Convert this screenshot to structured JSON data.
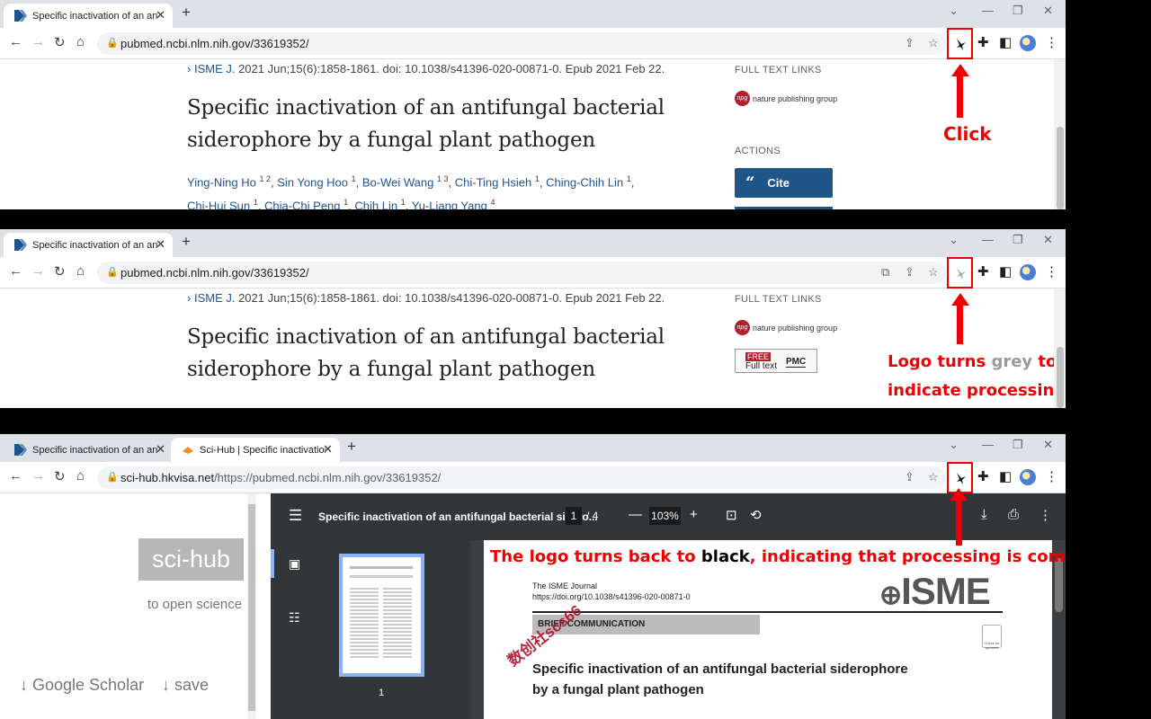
{
  "colors": {
    "annotation": "#ee0000",
    "tab_bar": "#dee1e6",
    "link": "#205493",
    "cite_button": "#20558a",
    "pdf_toolbar": "#323639"
  },
  "panels": {
    "p1": {
      "tab_title": "Specific inactivation of an antifun",
      "url": "pubmed.ncbi.nlm.nih.gov/33619352/",
      "journal_link": "ISME J.",
      "journal_rest": " 2021 Jun;15(6):1858-1861. doi: 10.1038/s41396-020-00871-0. Epub 2021 Feb 22.",
      "title_line1": "Specific inactivation of an antifungal bacterial",
      "title_line2": "siderophore by a fungal plant pathogen",
      "authors": [
        {
          "name": "Ying-Ning Ho",
          "sup": "1 2"
        },
        {
          "name": "Sin Yong Hoo",
          "sup": "1"
        },
        {
          "name": "Bo-Wei Wang",
          "sup": "1 3"
        },
        {
          "name": "Chi-Ting Hsieh",
          "sup": "1"
        },
        {
          "name": "Ching-Chih Lin",
          "sup": "1"
        },
        {
          "name": "Chi-Hui Sun",
          "sup": "1"
        },
        {
          "name": "Chia-Chi Peng",
          "sup": "1"
        },
        {
          "name": "Chih Lin",
          "sup": "1"
        },
        {
          "name": "Yu-Liang Yang",
          "sup": "4"
        }
      ],
      "full_text_links": "FULL TEXT LINKS",
      "npg_label": "nature publishing group",
      "npg_logo": "npg",
      "actions": "ACTIONS",
      "cite_icon": "“",
      "cite": "Cite",
      "annotation": "Click"
    },
    "p2": {
      "tab_title": "Specific inactivation of an antifun",
      "url": "pubmed.ncbi.nlm.nih.gov/33619352/",
      "journal_link": "ISME J.",
      "journal_rest": " 2021 Jun;15(6):1858-1861. doi: 10.1038/s41396-020-00871-0. Epub 2021 Feb 22.",
      "title_line1": "Specific inactivation of an antifungal bacterial",
      "title_line2": "siderophore by a fungal plant pathogen",
      "full_text_links": "FULL TEXT LINKS",
      "npg_label": "nature publishing group",
      "npg_logo": "npg",
      "free": "FREE",
      "full_text": "Full text",
      "pmc": "PMC",
      "annotation_a": "Logo turns ",
      "annotation_grey": "grey",
      "annotation_b": " to",
      "annotation_c": "indicate processing"
    },
    "p3": {
      "tab1_title": "Specific inactivation of an antifun",
      "tab2_title": "Sci-Hub | Specific inactivation of",
      "url_host": "sci-hub.hkvisa.net",
      "url_path": "/https://pubmed.ncbi.nlm.nih.gov/33619352/",
      "scihub_logo": "sci-hub",
      "scihub_sub": "to open science",
      "google_scholar": "↓ Google Scholar",
      "save": "↓ save",
      "pdf_title": "Specific inactivation of an antifungal bacterial sidero...",
      "page_current": "1",
      "page_total": "/ 4",
      "zoom": "103%",
      "thumb_page_number": "1",
      "annotation_a": "The logo turns back to ",
      "annotation_black": "black",
      "annotation_b": ", indicating that processing is complete",
      "journal_name": "The ISME Journal",
      "doi": "https://doi.org/10.1038/s41396-020-00871-0",
      "isme_logo": "ISME",
      "brief": "BRIEF COMMUNICATION",
      "paper_title_1": "Specific inactivation of an antifungal bacterial siderophore",
      "paper_title_2": "by a fungal plant pathogen",
      "check_updates": "Check for updates",
      "watermark": "数创社scs66"
    }
  }
}
